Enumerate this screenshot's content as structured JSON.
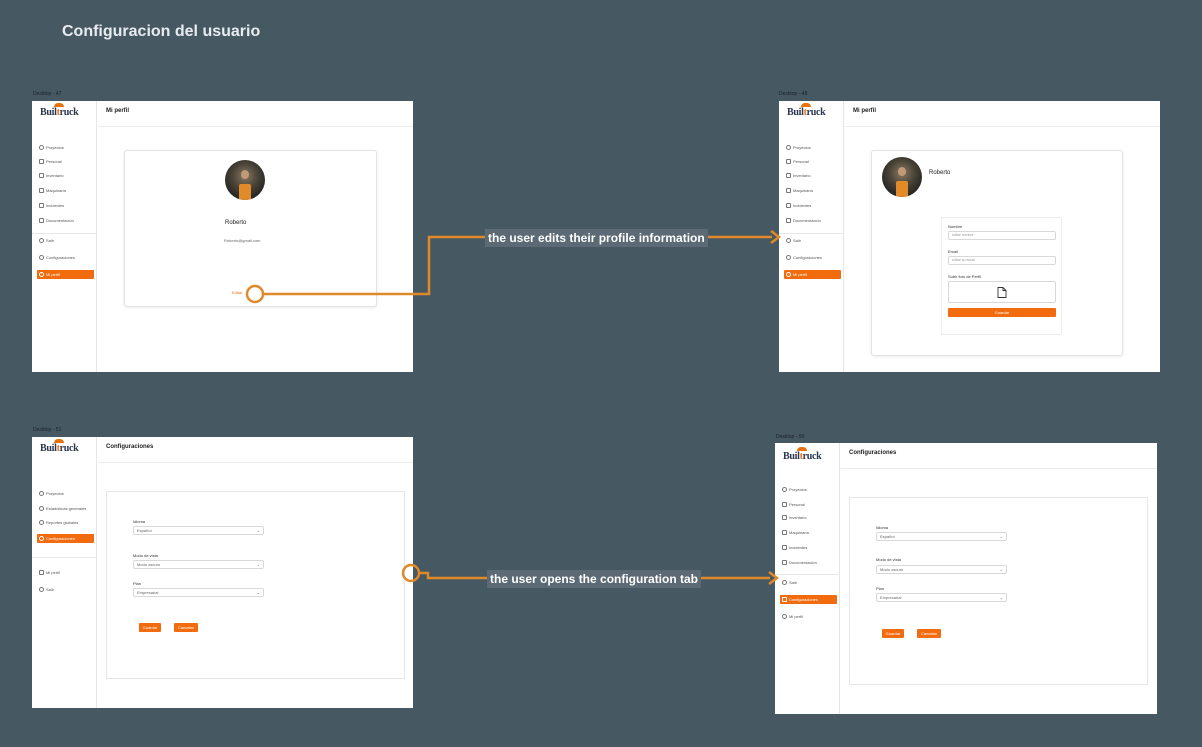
{
  "board_title": "Configuracion del usuario",
  "accent_color": "#f26b0f",
  "connector_color": "#e0892a",
  "logo_text_before": "Buil",
  "logo_text_t": "t",
  "logo_text_after": "ruck",
  "frames": {
    "f1": {
      "label": "Desktop - 47",
      "header": "Mi perfil",
      "nav": [
        "Proyectos",
        "Personal",
        "Inventario",
        "Maquinaria",
        "Incidentes",
        "Documentación",
        "Salir",
        "Configuraciones",
        "Mi perfil"
      ],
      "profile_name": "Roberto",
      "profile_email": "Roberto@gmail.com",
      "edit_link": "Editar"
    },
    "f2": {
      "label": "Desktop - 48",
      "header": "Mi perfil",
      "nav": [
        "Proyectos",
        "Personal",
        "Inventario",
        "Maquinaria",
        "Incidentes",
        "Documentación",
        "Salir",
        "Configuraciones",
        "Mi perfil"
      ],
      "profile_name": "Roberto",
      "name_label": "Nombre",
      "name_placeholder": "editar nombre",
      "email_label": "Email",
      "email_placeholder": "editar su email",
      "photo_label": "Subir foto de Perfil",
      "save_button": "Guardar"
    },
    "f3": {
      "label": "Desktop - 51",
      "header": "Configuraciones",
      "nav": [
        "Proyectos",
        "Estadísticas generales",
        "Reportes globales",
        "Configuraciones",
        "Mi perfil",
        "Salir"
      ],
      "language_label": "Idioma",
      "language_value": "Español",
      "mode_label": "Modo de vista",
      "mode_value": "Modo oscuro",
      "plan_label": "Plan",
      "plan_value": "Empresarial",
      "save_button": "Guardar",
      "cancel_button": "Cancelar"
    },
    "f4": {
      "label": "Desktop - 50",
      "header": "Configuraciones",
      "nav": [
        "Proyectos",
        "Personal",
        "Inventario",
        "Maquinaria",
        "Incidentes",
        "Documentación",
        "Salir",
        "Configuraciones",
        "Mi perfil"
      ],
      "language_label": "Idioma",
      "language_value": "Español",
      "mode_label": "Modo de vista",
      "mode_value": "Modo oscuro",
      "plan_label": "Plan",
      "plan_value": "Empresarial",
      "save_button": "Guardar",
      "cancel_button": "Cancelar"
    }
  },
  "connectors": {
    "top": "the user edits their profile information",
    "bottom": "the user opens the configuration tab"
  }
}
